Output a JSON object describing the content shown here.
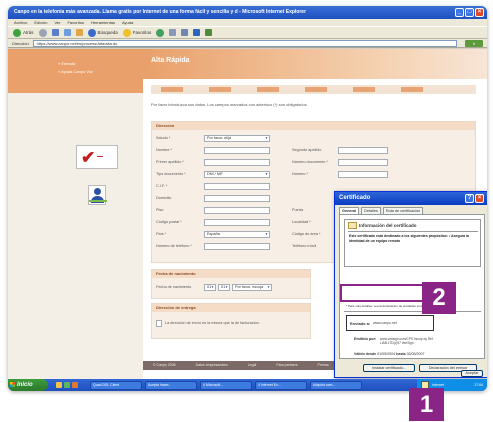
{
  "browser": {
    "title": "Canpo en la telefonia más avanzada. Llama gratis por Internet de una forma fácil y sencilla y d - Microsoft Internet Explorer",
    "menus": [
      "Archivo",
      "Edición",
      "Ver",
      "Favoritos",
      "Herramientas",
      "Ayuda"
    ],
    "toolbar": {
      "back": "Atrás",
      "search": "Búsqueda",
      "favorites": "Favoritos"
    },
    "address_label": "Dirección",
    "address": "https://www.canpo.net/es/process/Alta/alta.do",
    "go_label": "Ir"
  },
  "page": {
    "left_links": [
      "» Entrada",
      "» Ayuda Canpo Voz"
    ],
    "title": "Alta Rápida",
    "intro": "Por favor introduzca sus datos. Los campos marcados con asterisco (*) son obligatorios.",
    "sections": {
      "address_title": "Dirección",
      "birth_title": "Fecha de nacimiento",
      "delivery_title": "Dirección de entrega",
      "delivery_check": "La dirección de envío es la misma que la de facturación."
    },
    "form": {
      "left_labels": [
        "Saludo *",
        "Nombre *",
        "Primer apellido *",
        "Tipo documento *",
        "C.I.F. *",
        "Domicilio",
        "Piso",
        "Código postal *",
        "País *",
        "Número de teléfono *"
      ],
      "right_labels": [
        "Segundo apellido",
        "Número documento *",
        "Número *",
        "Puerta",
        "Localidad *",
        "Código de área *",
        "Teléfono móvil"
      ],
      "saludo_value": "Por favor, elija",
      "doc_type_value": "DNI / NIF",
      "country_value": "España",
      "birth_label": "Fecha de nacimiento",
      "birth_day": "01",
      "birth_month": "01",
      "birth_year": "Por favor, escoja"
    },
    "footer": [
      "© Canpo 2006",
      "Datos empresariales",
      "Legal",
      "Para partners",
      "Prensa",
      "Trabajos"
    ]
  },
  "cert_dialog": {
    "title": "Certificado",
    "tabs": [
      "General",
      "Detalles",
      "Ruta de certificación"
    ],
    "info_title": "Información del certificado",
    "purpose_text": "Este certificado está destinado a los siguientes propósitos: • Asegura la identidad de un equipo remoto",
    "note": "* Para más detalles, vea la declaración de entidades emisoras de certificados",
    "issued_to_label": "Enviado a:",
    "issued_to_value": "www.canpo.net",
    "issued_by_label": "Emitido por:",
    "issued_by_value": "www.verisign.com/CPS Incorp.by Ref. LIAB.LTD(c)97 VeriSign",
    "valid_label": "Válido desde",
    "valid_from": "01/05/2004",
    "valid_to_label": "hasta",
    "valid_to": "02/05/2007",
    "btn_install": "Instalar certificado...",
    "btn_issuer": "Declaración del emisor",
    "btn_accept": "Aceptar"
  },
  "taskbar": {
    "start": "Inicio",
    "tasks": [
      "Quad DSL Client",
      "Acepta hacer...",
      "4 Microsoft...",
      "4 Internet Ex...",
      "Adquirir.com..."
    ],
    "tray_label": "Internet",
    "clock": "17:54"
  },
  "callouts": {
    "one": "1",
    "two": "2"
  },
  "colors": {
    "accent": "#e9a06a",
    "callout": "#8a2486",
    "xp_blue": "#1e4fbf"
  }
}
